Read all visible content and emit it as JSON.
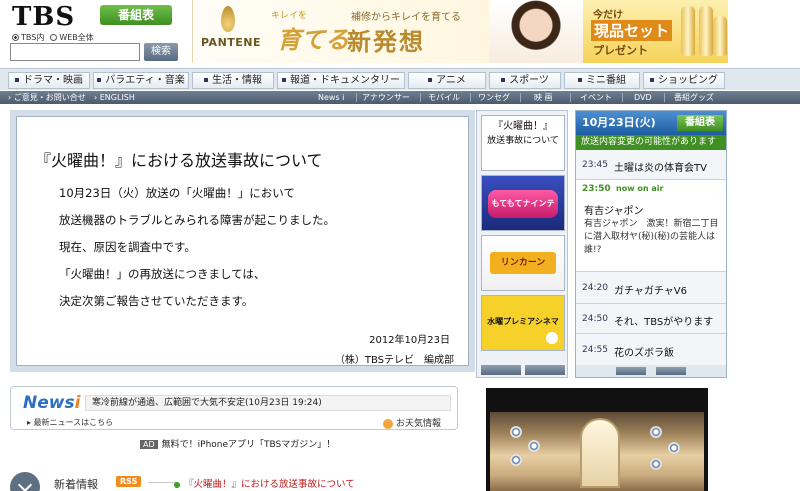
{
  "header": {
    "logo": "TBS",
    "program_guide_button": "番組表",
    "search": {
      "radio_tbs": "TBS内",
      "radio_web": "WEB全体",
      "button": "検索"
    }
  },
  "banner": {
    "brand": "PANTENE",
    "catch_small": "キレイを",
    "catch_big": "育てる",
    "sub": "補修からキレイを育てる",
    "title": "新発想",
    "present_line1": "今だけ",
    "present_line2": "現品セット",
    "present_line3": "プレゼント"
  },
  "nav_primary": [
    "ドラマ・映画",
    "バラエティ・音楽",
    "生活・情報",
    "報道・ドキュメンタリー",
    "アニメ",
    "スポーツ",
    "ミニ番組",
    "ショッピング"
  ],
  "nav_secondary": {
    "left": [
      "ご意見・お問い合せ",
      "ENGLISH"
    ],
    "right": [
      "News i",
      "アナウンサー",
      "モバイル",
      "ワンセグ",
      "映 画",
      "イベント",
      "DVD",
      "番組グッズ"
    ]
  },
  "notice": {
    "title": "『火曜曲！』における放送事故について",
    "lines": [
      "10月23日（火）放送の「火曜曲！」において",
      "放送機器のトラブルとみられる障害が起こりました。",
      "現在、原因を調査中です。",
      "「火曜曲！」の再放送につきましては、",
      "決定次第ご報告させていただきます。"
    ],
    "date": "2012年10月23日",
    "org": "（株）TBSテレビ　編成部"
  },
  "thumbs": {
    "first_title": "『火曜曲！』",
    "first_sub": "放送事故について",
    "second": "もてもてナインティナイン",
    "third": "リンカーン",
    "fourth": "水曜プレミアシネマ"
  },
  "schedule": {
    "date": "10月23日(火)",
    "guide_button": "番組表",
    "warning": "放送内容変更の可能性があります",
    "rows": [
      {
        "time": "23:45",
        "program": "土曜は炎の体育会TV"
      },
      {
        "time": "24:20",
        "program": "ガチャガチャV6"
      },
      {
        "time": "24:50",
        "program": "それ、TBSがやります"
      },
      {
        "time": "24:55",
        "program": "花のズボラ飯"
      }
    ],
    "now": {
      "time": "23:50",
      "badge": "now on air",
      "title": "有吉ジャポン",
      "desc": "有吉ジャポン　激実！新宿二丁目に潜入取材ヤ(秘)(秘)の芸能人は誰!?"
    }
  },
  "news": {
    "logo_main": "News",
    "logo_i": "i",
    "ticker": "寒冷前線が通過、広範囲で大気不安定(10月23日 19:24)",
    "latest": "最新ニュースはこちら",
    "weather": "お天気情報"
  },
  "ad": {
    "tag": "AD",
    "text": "無料で！iPhoneアプリ「TBSマガジン」！"
  },
  "new_info": {
    "label": "新着情報",
    "rss": "RSS",
    "link": "『火曜曲！』における放送事故について"
  },
  "colors": {
    "accent_green": "#3f8f22",
    "nav_dark": "#4c5a6c",
    "schedule_blue": "#1d5da3",
    "alert_red": "#c01818"
  }
}
